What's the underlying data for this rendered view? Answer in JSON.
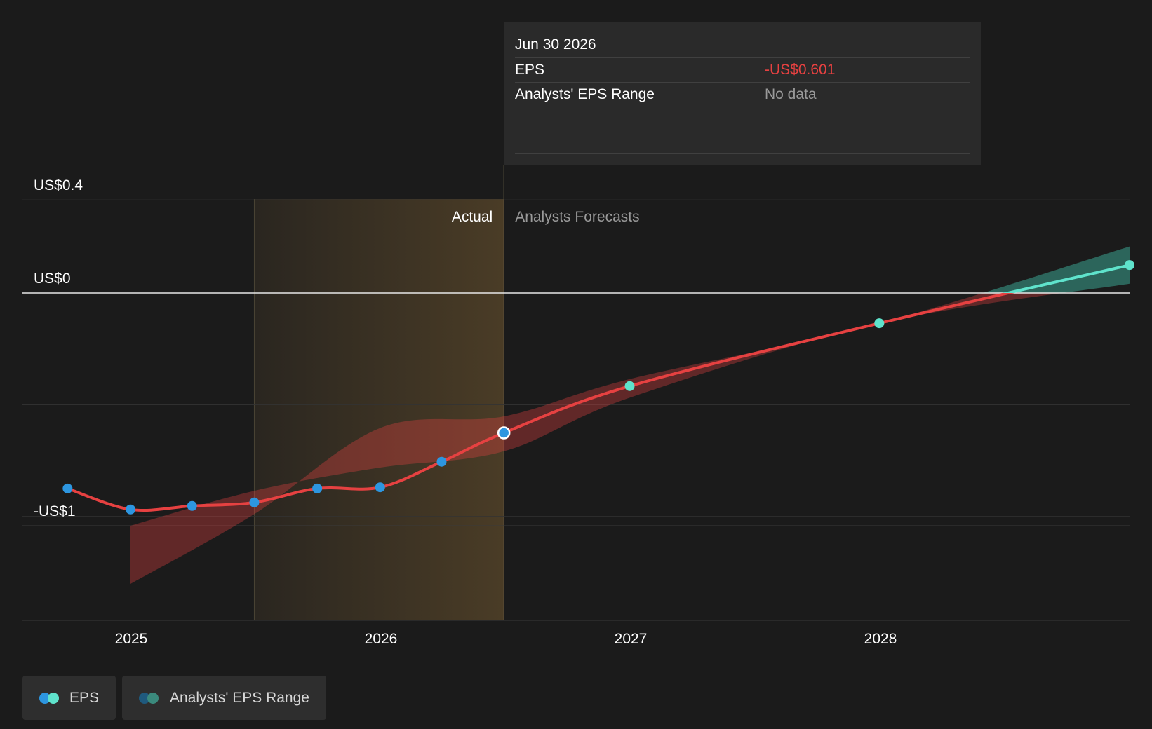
{
  "tooltip": {
    "date": "Jun 30 2026",
    "eps_label": "EPS",
    "eps_value": "-US$0.601",
    "range_label": "Analysts' EPS Range",
    "range_value": "No data"
  },
  "regions": {
    "actual_label": "Actual",
    "forecast_label": "Analysts Forecasts"
  },
  "legend": {
    "eps_label": "EPS",
    "range_label": "Analysts' EPS Range"
  },
  "colors": {
    "background": "#1b1b1b",
    "eps_line": "#e64141",
    "eps_positive_line": "#5fe3cc",
    "actual_point": "#2d96e0",
    "forecast_point": "#5fe3cc",
    "actual_shade": "#4a3c26",
    "range_band": "#e64141",
    "range_band_positive": "#3aa38f"
  },
  "chart_data": {
    "type": "line",
    "title": "",
    "xlabel": "",
    "ylabel": "",
    "x_ticks": [
      "2025",
      "2026",
      "2027",
      "2028"
    ],
    "y_ticks": [
      "US$0.4",
      "US$0",
      "-US$1"
    ],
    "y_tick_values": [
      0.4,
      0,
      -1
    ],
    "ylim": [
      -1.1,
      0.4
    ],
    "xlim": [
      "2024-09-01",
      "2028-12-31"
    ],
    "actual_period": [
      "2025-06-30",
      "2026-06-30"
    ],
    "grid": true,
    "legend_position": "bottom-left",
    "series": [
      {
        "name": "EPS",
        "kind": "actual",
        "points": [
          {
            "date": "2024-09-30",
            "value": -0.84
          },
          {
            "date": "2024-12-31",
            "value": -0.93
          },
          {
            "date": "2025-03-31",
            "value": -0.915
          },
          {
            "date": "2025-06-30",
            "value": -0.9
          },
          {
            "date": "2025-09-30",
            "value": -0.84
          },
          {
            "date": "2025-12-31",
            "value": -0.835
          },
          {
            "date": "2026-03-31",
            "value": -0.725
          },
          {
            "date": "2026-06-30",
            "value": -0.601
          }
        ]
      },
      {
        "name": "EPS",
        "kind": "forecast",
        "points": [
          {
            "date": "2026-06-30",
            "value": -0.601
          },
          {
            "date": "2026-12-31",
            "value": -0.4
          },
          {
            "date": "2027-12-31",
            "value": -0.13
          },
          {
            "date": "2028-12-31",
            "value": 0.12
          }
        ]
      },
      {
        "name": "Analysts' EPS Range",
        "kind": "range",
        "points": [
          {
            "date": "2024-12-31",
            "low": -1.25,
            "high": -1.0
          },
          {
            "date": "2025-06-30",
            "low": -0.95,
            "high": -0.85
          },
          {
            "date": "2025-12-31",
            "low": -0.58,
            "high": -0.75
          },
          {
            "date": "2026-06-30",
            "low": -0.53,
            "high": -0.68
          },
          {
            "date": "2026-12-31",
            "low": -0.37,
            "high": -0.45
          },
          {
            "date": "2027-12-31",
            "low": -0.13,
            "high": -0.13
          },
          {
            "date": "2028-12-31",
            "low": 0.2,
            "high": 0.04
          }
        ]
      }
    ],
    "highlight_date": "2026-06-30"
  }
}
